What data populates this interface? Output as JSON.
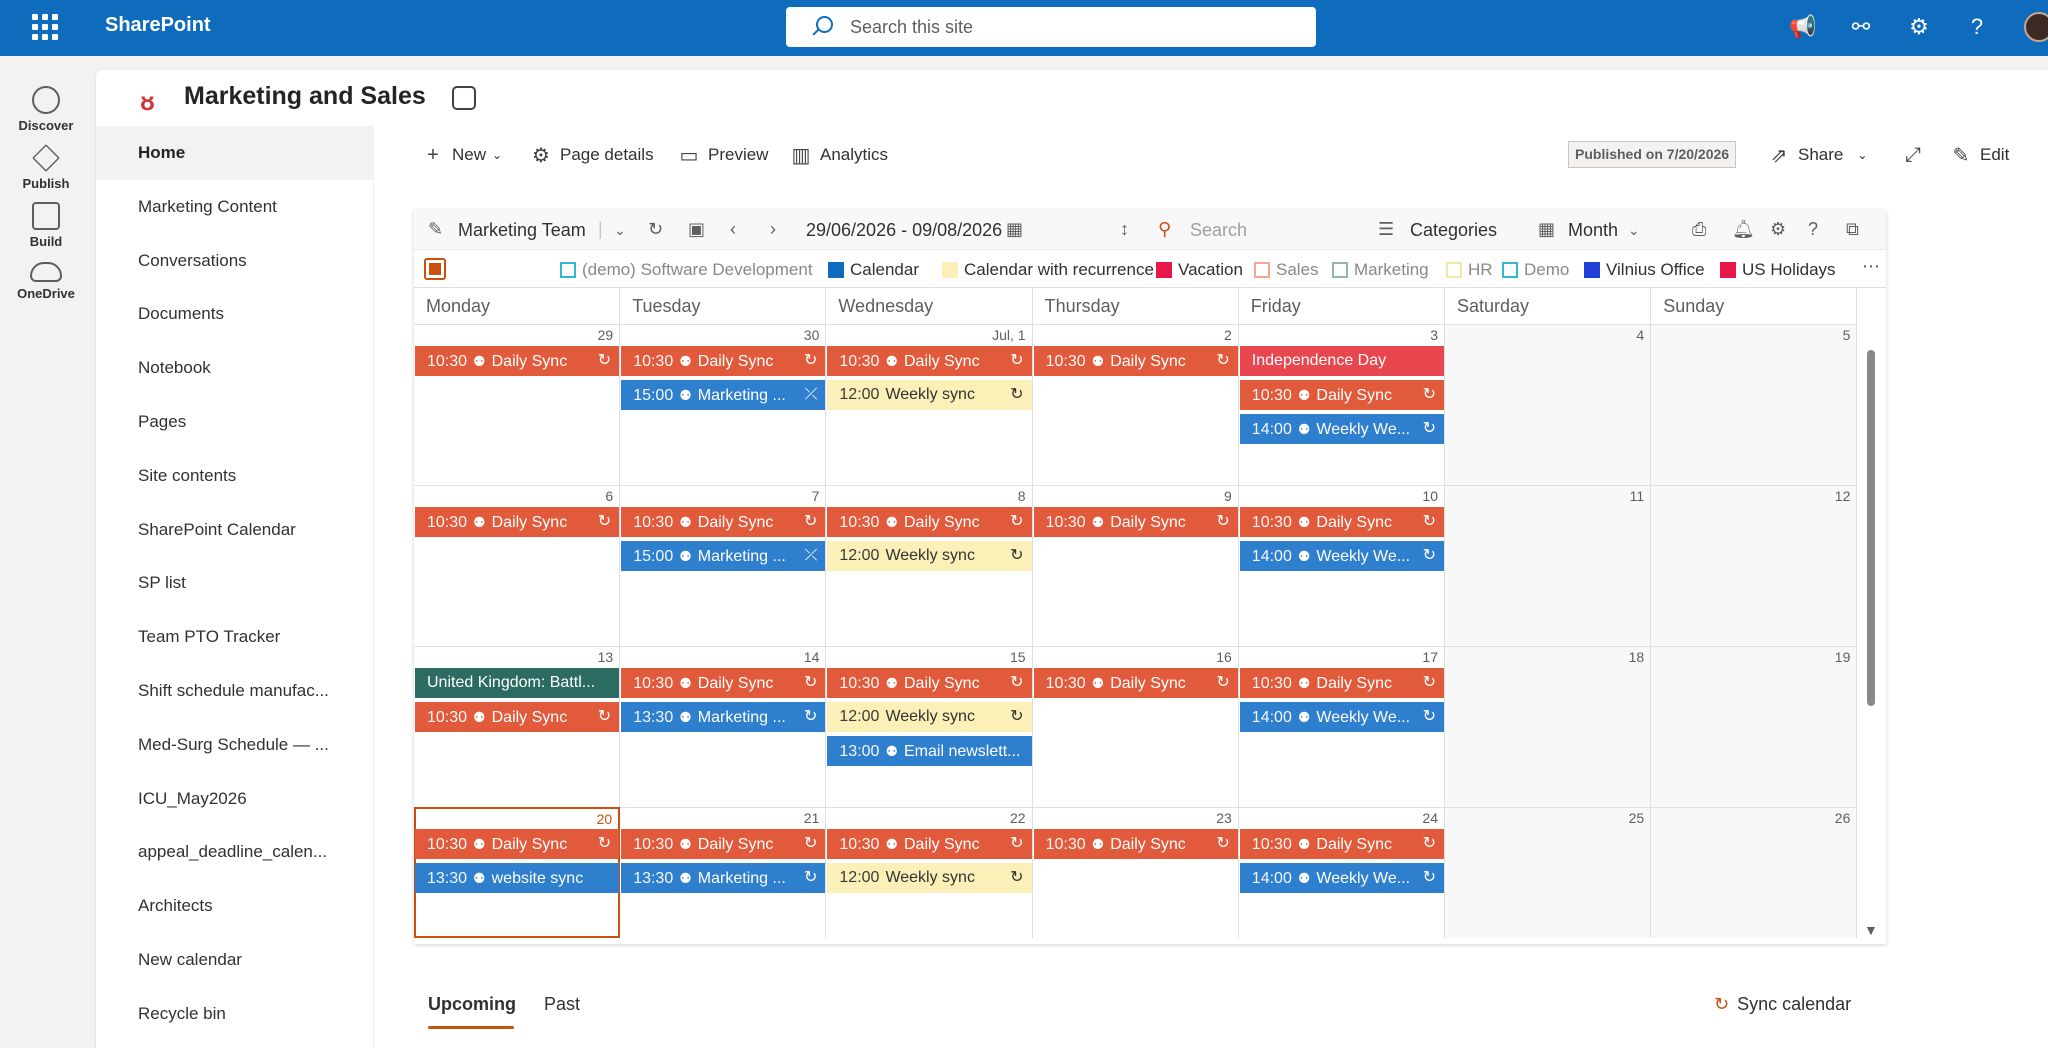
{
  "suite": {
    "brand": "SharePoint",
    "search_placeholder": "Search this site"
  },
  "rail": [
    {
      "label": "Discover",
      "icon": "compass-icon"
    },
    {
      "label": "Publish",
      "icon": "pen-icon"
    },
    {
      "label": "Build",
      "icon": "build-icon"
    },
    {
      "label": "OneDrive",
      "icon": "cloud-icon"
    }
  ],
  "site": {
    "title": "Marketing and Sales",
    "published": "Published on 7/20/2026"
  },
  "nav": [
    "Home",
    "Marketing Content",
    "Conversations",
    "Documents",
    "Notebook",
    "Pages",
    "Site contents",
    "SharePoint Calendar",
    "SP list",
    "Team PTO Tracker",
    "Shift schedule manufac...",
    "Med-Surg Schedule — ...",
    "ICU_May2026",
    "appeal_deadline_calen...",
    "Architects",
    "New calendar",
    "Recycle bin"
  ],
  "commands": {
    "new": "New",
    "page_details": "Page details",
    "preview": "Preview",
    "analytics": "Analytics",
    "share": "Share",
    "edit": "Edit"
  },
  "calendar": {
    "source": "Marketing Team",
    "range": "29/06/2026 - 09/08/2026",
    "search": "Search",
    "categories": "Categories",
    "view": "Month",
    "legend": [
      {
        "label": "(demo) Software Development",
        "color": "#33b5d6",
        "filled": false,
        "muted": true
      },
      {
        "label": "Calendar",
        "color": "#0f6cbd",
        "filled": true,
        "muted": false
      },
      {
        "label": "Calendar with recurrence",
        "color": "#fbf0b8",
        "filled": true,
        "muted": false
      },
      {
        "label": "Vacation",
        "color": "#e8174a",
        "filled": true,
        "muted": false
      },
      {
        "label": "Sales",
        "color": "#f4a98c",
        "filled": false,
        "muted": true
      },
      {
        "label": "Marketing",
        "color": "#8fb8a8",
        "filled": false,
        "muted": true
      },
      {
        "label": "HR",
        "color": "#f3e6a6",
        "filled": false,
        "muted": true
      },
      {
        "label": "Demo",
        "color": "#33b5d6",
        "filled": false,
        "muted": true
      },
      {
        "label": "Vilnius Office",
        "color": "#1f3fd6",
        "filled": true,
        "muted": false
      },
      {
        "label": "US Holidays",
        "color": "#e8174a",
        "filled": true,
        "muted": false
      }
    ],
    "days": [
      "Monday",
      "Tuesday",
      "Wednesday",
      "Thursday",
      "Friday",
      "Saturday",
      "Sunday"
    ],
    "weeks": [
      [
        "29",
        "30",
        "Jul, 1",
        "2",
        "3",
        "4",
        "5"
      ],
      [
        "6",
        "7",
        "8",
        "9",
        "10",
        "11",
        "12"
      ],
      [
        "13",
        "14",
        "15",
        "16",
        "17",
        "18",
        "19"
      ],
      [
        "20",
        "21",
        "22",
        "23",
        "24",
        "25",
        "26"
      ]
    ],
    "events": [
      {
        "w": 0,
        "d": 0,
        "s": 0,
        "time": "10:30",
        "title": "Daily Sync",
        "color": "orange",
        "teams": true,
        "recur": "↻"
      },
      {
        "w": 0,
        "d": 1,
        "s": 0,
        "time": "10:30",
        "title": "Daily Sync",
        "color": "orange",
        "teams": true,
        "recur": "↻"
      },
      {
        "w": 0,
        "d": 1,
        "s": 1,
        "time": "15:00",
        "title": "Marketing ...",
        "color": "blue",
        "teams": true,
        "recur": "⤫"
      },
      {
        "w": 0,
        "d": 2,
        "s": 0,
        "time": "10:30",
        "title": "Daily Sync",
        "color": "orange",
        "teams": true,
        "recur": "↻"
      },
      {
        "w": 0,
        "d": 2,
        "s": 1,
        "time": "12:00",
        "title": "Weekly sync",
        "color": "yellow",
        "teams": false,
        "recur": "↻"
      },
      {
        "w": 0,
        "d": 3,
        "s": 0,
        "time": "10:30",
        "title": "Daily Sync",
        "color": "orange",
        "teams": true,
        "recur": "↻"
      },
      {
        "w": 0,
        "d": 4,
        "s": 0,
        "time": "",
        "title": "Independence Day",
        "color": "red",
        "teams": false,
        "recur": ""
      },
      {
        "w": 0,
        "d": 4,
        "s": 1,
        "time": "10:30",
        "title": "Daily Sync",
        "color": "orange",
        "teams": true,
        "recur": "↻"
      },
      {
        "w": 0,
        "d": 4,
        "s": 2,
        "time": "14:00",
        "title": "Weekly We...",
        "color": "blue",
        "teams": true,
        "recur": "↻"
      },
      {
        "w": 1,
        "d": 0,
        "s": 0,
        "time": "10:30",
        "title": "Daily Sync",
        "color": "orange",
        "teams": true,
        "recur": "↻"
      },
      {
        "w": 1,
        "d": 1,
        "s": 0,
        "time": "10:30",
        "title": "Daily Sync",
        "color": "orange",
        "teams": true,
        "recur": "↻"
      },
      {
        "w": 1,
        "d": 1,
        "s": 1,
        "time": "15:00",
        "title": "Marketing ...",
        "color": "blue",
        "teams": true,
        "recur": "⤫"
      },
      {
        "w": 1,
        "d": 2,
        "s": 0,
        "time": "10:30",
        "title": "Daily Sync",
        "color": "orange",
        "teams": true,
        "recur": "↻"
      },
      {
        "w": 1,
        "d": 2,
        "s": 1,
        "time": "12:00",
        "title": "Weekly sync",
        "color": "yellow",
        "teams": false,
        "recur": "↻"
      },
      {
        "w": 1,
        "d": 3,
        "s": 0,
        "time": "10:30",
        "title": "Daily Sync",
        "color": "orange",
        "teams": true,
        "recur": "↻"
      },
      {
        "w": 1,
        "d": 4,
        "s": 0,
        "time": "10:30",
        "title": "Daily Sync",
        "color": "orange",
        "teams": true,
        "recur": "↻"
      },
      {
        "w": 1,
        "d": 4,
        "s": 1,
        "time": "14:00",
        "title": "Weekly We...",
        "color": "blue",
        "teams": true,
        "recur": "↻"
      },
      {
        "w": 2,
        "d": 0,
        "s": 0,
        "time": "",
        "title": "United Kingdom: Battl...",
        "color": "teal",
        "teams": false,
        "recur": ""
      },
      {
        "w": 2,
        "d": 0,
        "s": 1,
        "time": "10:30",
        "title": "Daily Sync",
        "color": "orange",
        "teams": true,
        "recur": "↻"
      },
      {
        "w": 2,
        "d": 1,
        "s": 0,
        "time": "10:30",
        "title": "Daily Sync",
        "color": "orange",
        "teams": true,
        "recur": "↻"
      },
      {
        "w": 2,
        "d": 1,
        "s": 1,
        "time": "13:30",
        "title": "Marketing ...",
        "color": "blue",
        "teams": true,
        "recur": "↻"
      },
      {
        "w": 2,
        "d": 2,
        "s": 0,
        "time": "10:30",
        "title": "Daily Sync",
        "color": "orange",
        "teams": true,
        "recur": "↻"
      },
      {
        "w": 2,
        "d": 2,
        "s": 1,
        "time": "12:00",
        "title": "Weekly sync",
        "color": "yellow",
        "teams": false,
        "recur": "↻"
      },
      {
        "w": 2,
        "d": 2,
        "s": 2,
        "time": "13:00",
        "title": "Email newslett...",
        "color": "blue",
        "teams": true,
        "recur": ""
      },
      {
        "w": 2,
        "d": 3,
        "s": 0,
        "time": "10:30",
        "title": "Daily Sync",
        "color": "orange",
        "teams": true,
        "recur": "↻"
      },
      {
        "w": 2,
        "d": 4,
        "s": 0,
        "time": "10:30",
        "title": "Daily Sync",
        "color": "orange",
        "teams": true,
        "recur": "↻"
      },
      {
        "w": 2,
        "d": 4,
        "s": 1,
        "time": "14:00",
        "title": "Weekly We...",
        "color": "blue",
        "teams": true,
        "recur": "↻"
      },
      {
        "w": 3,
        "d": 0,
        "s": 0,
        "time": "10:30",
        "title": "Daily Sync",
        "color": "orange",
        "teams": true,
        "recur": "↻"
      },
      {
        "w": 3,
        "d": 0,
        "s": 1,
        "time": "13:30",
        "title": "website sync",
        "color": "blue",
        "teams": true,
        "recur": ""
      },
      {
        "w": 3,
        "d": 1,
        "s": 0,
        "time": "10:30",
        "title": "Daily Sync",
        "color": "orange",
        "teams": true,
        "recur": "↻"
      },
      {
        "w": 3,
        "d": 1,
        "s": 1,
        "time": "13:30",
        "title": "Marketing ...",
        "color": "blue",
        "teams": true,
        "recur": "↻"
      },
      {
        "w": 3,
        "d": 2,
        "s": 0,
        "time": "10:30",
        "title": "Daily Sync",
        "color": "orange",
        "teams": true,
        "recur": "↻"
      },
      {
        "w": 3,
        "d": 2,
        "s": 1,
        "time": "12:00",
        "title": "Weekly sync",
        "color": "yellow",
        "teams": false,
        "recur": "↻"
      },
      {
        "w": 3,
        "d": 3,
        "s": 0,
        "time": "10:30",
        "title": "Daily Sync",
        "color": "orange",
        "teams": true,
        "recur": "↻"
      },
      {
        "w": 3,
        "d": 4,
        "s": 0,
        "time": "10:30",
        "title": "Daily Sync",
        "color": "orange",
        "teams": true,
        "recur": "↻"
      },
      {
        "w": 3,
        "d": 4,
        "s": 1,
        "time": "14:00",
        "title": "Weekly We...",
        "color": "blue",
        "teams": true,
        "recur": "↻"
      }
    ]
  },
  "tabs": {
    "upcoming": "Upcoming",
    "past": "Past",
    "sync": "Sync calendar"
  }
}
